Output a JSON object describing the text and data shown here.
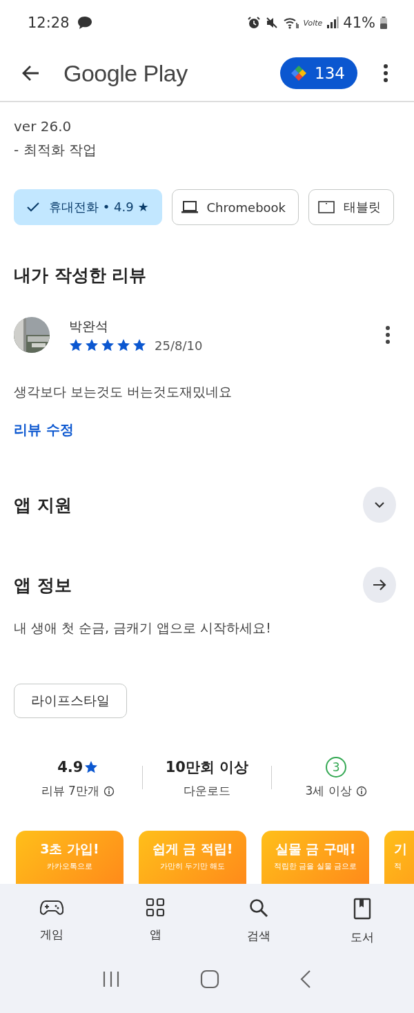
{
  "status_bar": {
    "time": "12:28",
    "network": "Volte",
    "battery": "41%"
  },
  "header": {
    "title": "Google Play",
    "points": "134"
  },
  "release_notes": [
    "ver 26.0",
    "- 최적화 작업"
  ],
  "devices": [
    {
      "label": "휴대전화 • 4.9 ★",
      "selected": true
    },
    {
      "label": "Chromebook",
      "kind": "laptop",
      "selected": false
    },
    {
      "label": "태블릿",
      "kind": "tablet",
      "selected": false
    }
  ],
  "my_review": {
    "heading": "내가 작성한 리뷰",
    "author": "박완석",
    "stars": 5,
    "date": "25/8/10",
    "text": "생각보다 보는것도 버는것도재밌네요",
    "edit_link": "리뷰 수정"
  },
  "app_support": {
    "heading": "앱 지원",
    "expanded": false
  },
  "app_info": {
    "heading": "앱 정보",
    "description": "내 생애 첫 순금, 금캐기 앱으로 시작하세요!",
    "tag": "라이프스타일"
  },
  "stats": [
    {
      "value": "4.9",
      "kind": "rating",
      "label": "리뷰 7만개",
      "info": true
    },
    {
      "value": "10만회 이상",
      "kind": "text",
      "label": "다운로드",
      "info": false
    },
    {
      "value": "3",
      "kind": "age",
      "label": "3세 이상",
      "info": true
    }
  ],
  "screenshots": [
    {
      "title": "3초 가입!",
      "subtitle": "카카오톡으로"
    },
    {
      "title": "쉽게 금 적립!",
      "subtitle": "가만히 두기만 해도"
    },
    {
      "title": "실물 금 구매!",
      "subtitle": "적립한 금을 실물 금으로"
    },
    {
      "title": "기",
      "subtitle": "적"
    }
  ],
  "bottom_nav": [
    {
      "label": "게임",
      "kind": "games"
    },
    {
      "label": "앱",
      "kind": "apps"
    },
    {
      "label": "검색",
      "kind": "search"
    },
    {
      "label": "도서",
      "kind": "books"
    }
  ]
}
